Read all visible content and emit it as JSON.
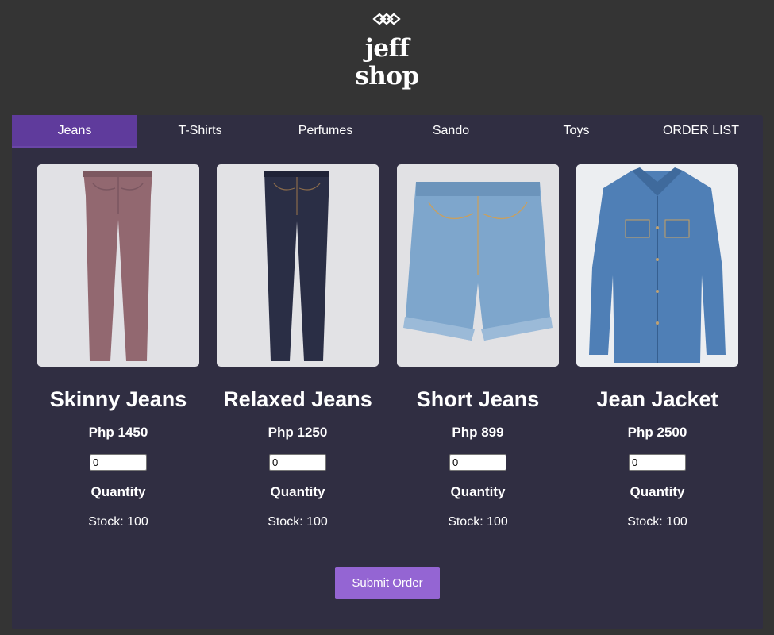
{
  "brand": {
    "line1": "jeff",
    "line2": "shop",
    "icon": "diamond-links-icon"
  },
  "tabs": [
    {
      "label": "Jeans",
      "active": true
    },
    {
      "label": "T-Shirts",
      "active": false
    },
    {
      "label": "Perfumes",
      "active": false
    },
    {
      "label": "Sando",
      "active": false
    },
    {
      "label": "Toys",
      "active": false
    },
    {
      "label": "ORDER LIST",
      "active": false
    }
  ],
  "products": [
    {
      "name": "Skinny Jeans",
      "price": "Php 1450",
      "quantity_value": "0",
      "quantity_label": "Quantity",
      "stock": "Stock: 100",
      "image": "mauve-skinny-jeans"
    },
    {
      "name": "Relaxed Jeans",
      "price": "Php 1250",
      "quantity_value": "0",
      "quantity_label": "Quantity",
      "stock": "Stock: 100",
      "image": "dark-denim-jeans"
    },
    {
      "name": "Short Jeans",
      "price": "Php 899",
      "quantity_value": "0",
      "quantity_label": "Quantity",
      "stock": "Stock: 100",
      "image": "light-denim-shorts"
    },
    {
      "name": "Jean Jacket",
      "price": "Php 2500",
      "quantity_value": "0",
      "quantity_label": "Quantity",
      "stock": "Stock: 100",
      "image": "denim-jacket"
    }
  ],
  "submit_label": "Submit Order",
  "colors": {
    "page_bg": "#343434",
    "panel_bg": "#302e42",
    "active_tab": "#5f3b9c",
    "button": "#9465d3"
  }
}
